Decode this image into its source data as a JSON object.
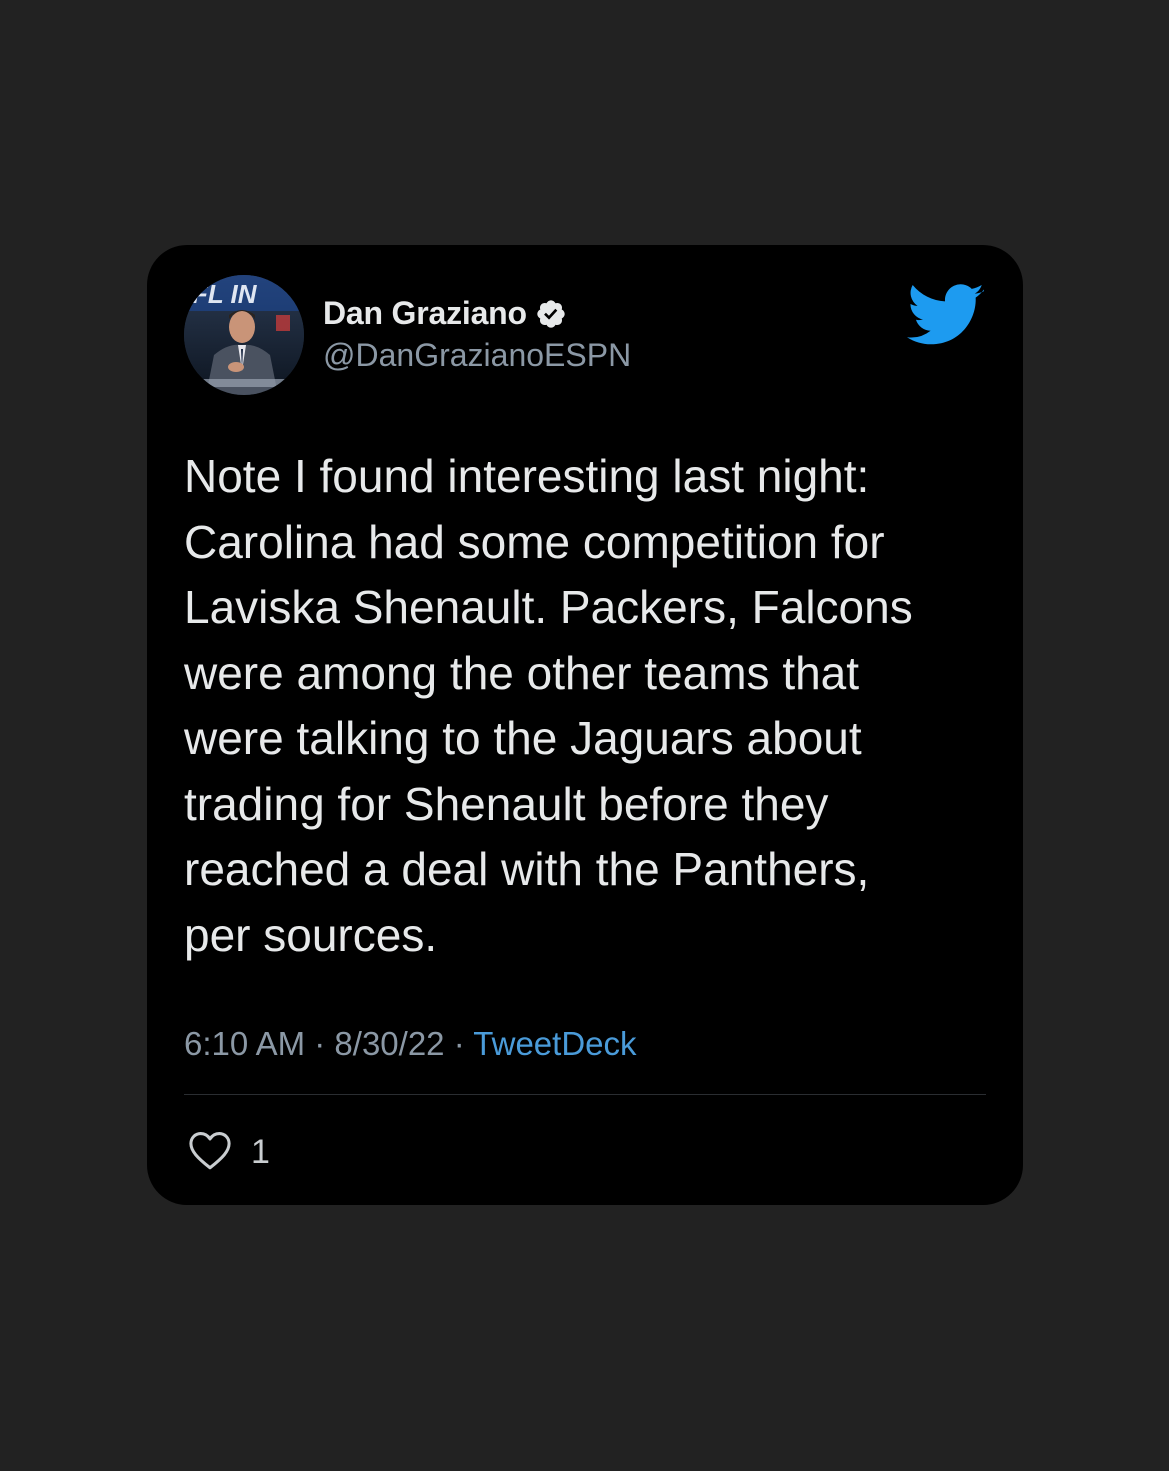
{
  "tweet": {
    "author": {
      "name": "Dan Graziano",
      "handle": "@DanGrazianoESPN",
      "verified": true,
      "avatar_icon": "profile-photo-avatar"
    },
    "platform_icon": "twitter-bird-icon",
    "text": "Note I found interesting last night:\nCarolina had some competition for\nLaviska Shenault. Packers, Falcons\nwere among the other teams that\nwere talking to the Jaguars about\ntrading for Shenault before they\nreached a deal with the Panthers,\nper sources.",
    "time": "6:10 AM",
    "separator": "·",
    "date": "8/30/22",
    "source": "TweetDeck",
    "likes": "1",
    "colors": {
      "page_background": "#222222",
      "card_background": "#000000",
      "accent": "#1d9bf0",
      "source_link": "#4a9bd9",
      "text_primary": "#e7e9ea",
      "text_secondary": "#8b98a5"
    }
  }
}
